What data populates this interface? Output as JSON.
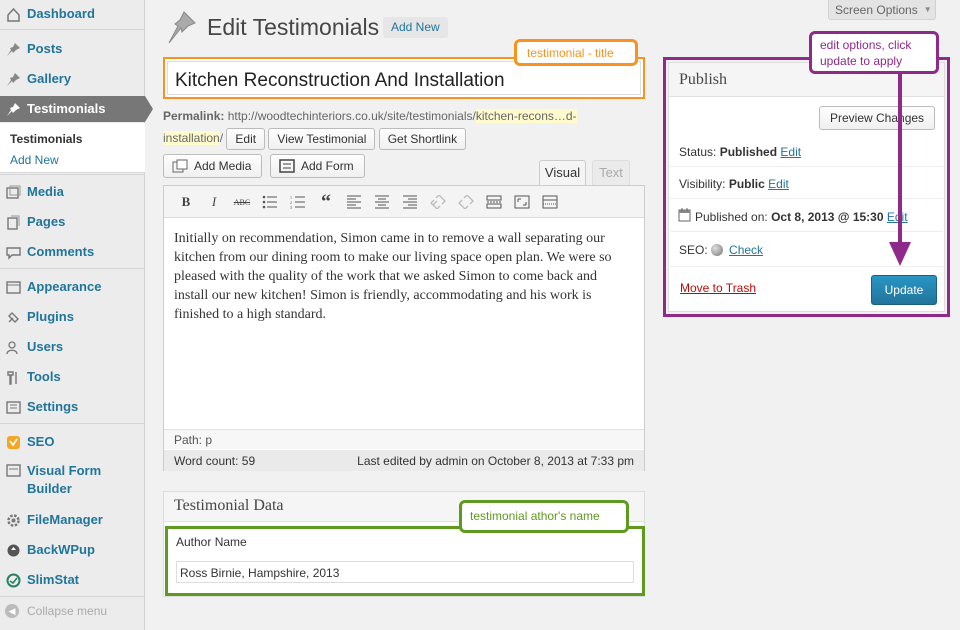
{
  "sidebar": {
    "items": [
      {
        "id": "dashboard",
        "label": "Dashboard",
        "icon": "dashboard-icon"
      },
      {
        "id": "posts",
        "label": "Posts",
        "icon": "pin-icon"
      },
      {
        "id": "gallery",
        "label": "Gallery",
        "icon": "pin-icon"
      },
      {
        "id": "testimonials",
        "label": "Testimonials",
        "icon": "pin-icon",
        "active": true
      },
      {
        "id": "media",
        "label": "Media",
        "icon": "media-icon"
      },
      {
        "id": "pages",
        "label": "Pages",
        "icon": "pages-icon"
      },
      {
        "id": "comments",
        "label": "Comments",
        "icon": "comment-icon"
      },
      {
        "id": "appearance",
        "label": "Appearance",
        "icon": "appearance-icon"
      },
      {
        "id": "plugins",
        "label": "Plugins",
        "icon": "plugin-icon"
      },
      {
        "id": "users",
        "label": "Users",
        "icon": "users-icon"
      },
      {
        "id": "tools",
        "label": "Tools",
        "icon": "tools-icon"
      },
      {
        "id": "settings",
        "label": "Settings",
        "icon": "settings-icon"
      },
      {
        "id": "seo",
        "label": "SEO",
        "icon": "seo-icon"
      },
      {
        "id": "visual-form-builder",
        "label": "Visual Form Builder",
        "icon": "form-icon"
      },
      {
        "id": "filemanager",
        "label": "FileManager",
        "icon": "gear-icon"
      },
      {
        "id": "backwpup",
        "label": "BackWPup",
        "icon": "backup-icon"
      },
      {
        "id": "slimstat",
        "label": "SlimStat",
        "icon": "stats-icon"
      }
    ],
    "submenu": {
      "current": "Testimonials",
      "add_new": "Add New"
    },
    "collapse": "Collapse menu"
  },
  "header": {
    "screen_options": "Screen Options",
    "title": "Edit Testimonials",
    "add_new": "Add New"
  },
  "post": {
    "title": "Kitchen Reconstruction And Installation",
    "permalink_label": "Permalink:",
    "permalink_base": "http://woodtechinteriors.co.uk/site/testimonials/",
    "permalink_slug_a": "kitchen-recons…d-",
    "permalink_slug_b": "installation",
    "permalink_end": "/",
    "edit_btn": "Edit",
    "view_btn": "View Testimonial",
    "shortlink_btn": "Get Shortlink"
  },
  "editor": {
    "add_media": "Add Media",
    "add_form": "Add Form",
    "tab_visual": "Visual",
    "tab_text": "Text",
    "content": "Initially on recommendation, Simon came in to remove a wall separating our kitchen from our dining room to make our living space open plan. We were so pleased with the quality of the work that we asked Simon to come back and install our new kitchen! Simon is friendly, accommodating and his work is finished to a high standard.",
    "path": "Path: p",
    "word_count": "Word count: 59",
    "last_edited": "Last edited by admin on October 8, 2013 at 7:33 pm",
    "toolbar": {
      "bold": "B",
      "italic": "I",
      "strike": "ABC",
      "blockquote": "“"
    }
  },
  "testimonial_data": {
    "heading": "Testimonial Data",
    "author_label": "Author Name",
    "author_value": "Ross Birnie, Hampshire, 2013"
  },
  "publish": {
    "heading": "Publish",
    "preview": "Preview Changes",
    "status_label": "Status:",
    "status_value": "Published",
    "visibility_label": "Visibility:",
    "visibility_value": "Public",
    "published_label": "Published on:",
    "published_value": "Oct 8, 2013 @ 15:30",
    "seo_label": "SEO:",
    "seo_check": "Check",
    "edit": "Edit",
    "trash": "Move to Trash",
    "update": "Update"
  },
  "annotations": {
    "title": "testimonial - title",
    "publish": "edit options, click update to apply",
    "author": "testimonial athor's name"
  },
  "colors": {
    "link": "#21759b",
    "annotation_orange": "#f7931e",
    "annotation_purple": "#8f2a8a",
    "annotation_green": "#5e9a1f",
    "update_button": "#21759b"
  }
}
